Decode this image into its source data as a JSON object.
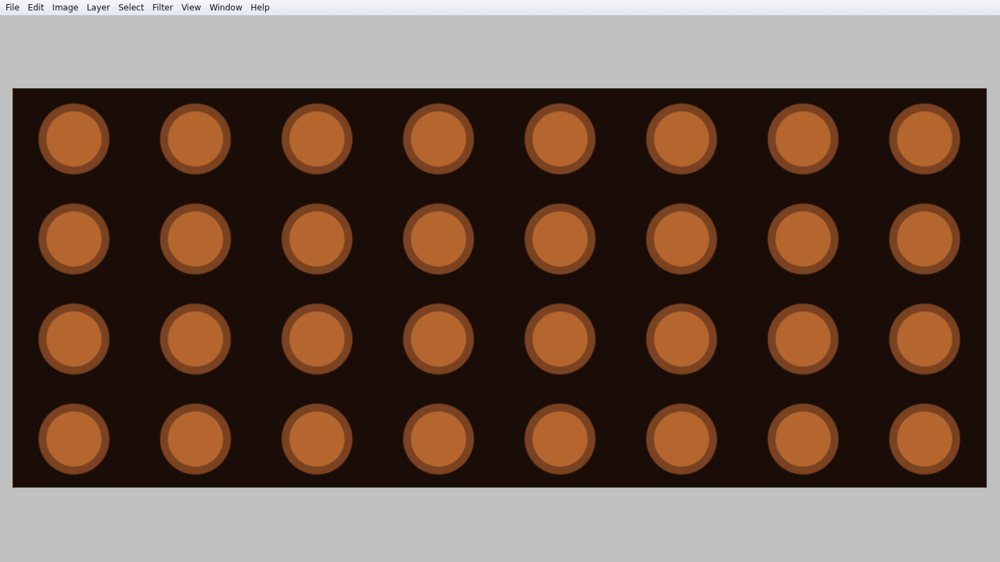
{
  "menu_bar": {
    "items": [
      {
        "label": "File"
      },
      {
        "label": "Edit"
      },
      {
        "label": "Image"
      },
      {
        "label": "Layer"
      },
      {
        "label": "Select"
      },
      {
        "label": "Filter"
      },
      {
        "label": "View"
      },
      {
        "label": "Window"
      },
      {
        "label": "Help"
      }
    ]
  }
}
